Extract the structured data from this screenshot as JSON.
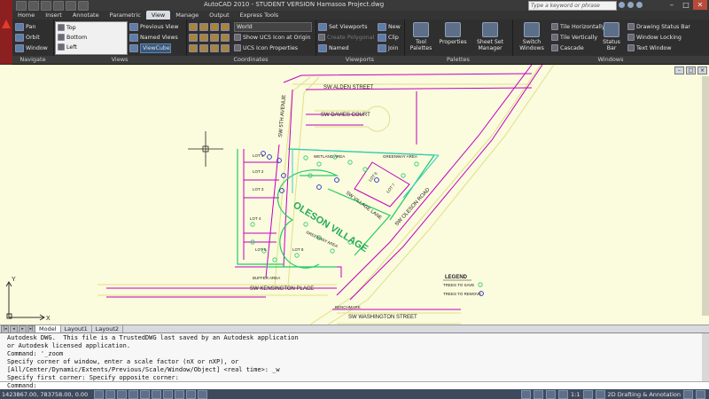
{
  "window": {
    "title": "AutoCAD 2010 - STUDENT VERSION    Hamasoa Project.dwg",
    "search_placeholder": "Type a keyword or phrase",
    "minimize": "–",
    "maximize": "□",
    "close": "✕"
  },
  "ribbon_tabs": [
    "Home",
    "Insert",
    "Annotate",
    "Parametric",
    "View",
    "Manage",
    "Output",
    "Express Tools"
  ],
  "active_tab": "View",
  "panels": {
    "navigate": {
      "title": "Navigate",
      "pan": "Pan",
      "orbit": "Orbit",
      "window": "Window"
    },
    "views": {
      "title": "Views",
      "list": [
        "Top",
        "Bottom",
        "Left"
      ],
      "previous_view": "Previous View",
      "named_views": "Named Views",
      "viewcube": "ViewCube"
    },
    "coordinates": {
      "title": "Coordinates",
      "ucs_combo": "World",
      "show_ucs": "Show UCS Icon at Origin",
      "ucs_properties": "UCS Icon Properties"
    },
    "viewports": {
      "title": "Viewports",
      "set_viewports": "Set Viewports",
      "create_polygonal": "Create Polygonal",
      "named": "Named",
      "new": "New",
      "clip": "Clip",
      "join": "Join"
    },
    "palettes": {
      "title": "Palettes",
      "tool_palettes": "Tool Palettes",
      "properties": "Properties",
      "sheet_set_manager": "Sheet Set Manager"
    },
    "windows": {
      "title": "Windows",
      "switch_windows": "Switch Windows",
      "tile_horizontally": "Tile Horizontally",
      "tile_vertically": "Tile Vertically",
      "cascade": "Cascade",
      "status_bar": "Status Bar",
      "drawing_status_bar": "Drawing Status Bar",
      "window_locking": "Window Locking",
      "text_window": "Text Window"
    }
  },
  "drawing": {
    "streets": {
      "alden": "SW ALDEN STREET",
      "davies": "SW DAVIES COURT",
      "fifth": "SW 5TH AVENUE",
      "village_lane": "SW VILLAGE LANE",
      "oleson_road": "SW OLESON ROAD",
      "kensington": "SW KENSINGTON PLACE",
      "washington": "SW WASHINGTON STREET"
    },
    "title": "OLESON VILLAGE",
    "areas": {
      "wetland": "WETLAND AREA",
      "greenway_1": "GREENWAY AREA",
      "greenway_2": "GREENWAY AREA",
      "buffer": "BUFFER AREA",
      "benchmark": "BENCHMARK"
    },
    "lots": [
      "LOT 1",
      "LOT 2",
      "LOT 3",
      "LOT 4",
      "LOT 5",
      "LOT 6",
      "LOT 7",
      "LOT 8"
    ],
    "legend": {
      "title": "LEGEND",
      "save": "TREES TO SAVE",
      "remove": "TREES TO REMOVE"
    },
    "ucs": {
      "x": "X",
      "y": "Y"
    }
  },
  "layout_tabs": [
    "Model",
    "Layout1",
    "Layout2"
  ],
  "active_layout": "Model",
  "command_history": [
    "Autodesk DWG.  This file is a TrustedDWG last saved by an Autodesk application",
    "or Autodesk licensed application.",
    "Command: '_zoom",
    "Specify corner of window, enter a scale factor (nX or nXP), or",
    "[All/Center/Dynamic/Extents/Previous/Scale/Window/Object] <real time>: _w",
    "Specify first corner: Specify opposite corner:"
  ],
  "command_prompt": "Command:",
  "status": {
    "coordinates": "1423867.00, 783758.00, 0.00",
    "annotation_scale": "1:1",
    "workspace": "2D Drafting & Annotation"
  },
  "colors": {
    "canvas": "#fbfbdd",
    "road": "#e0e08a",
    "property": "#c000c0",
    "green": "#22cc66",
    "cyan": "#33cccc",
    "blue": "#2222cc"
  }
}
